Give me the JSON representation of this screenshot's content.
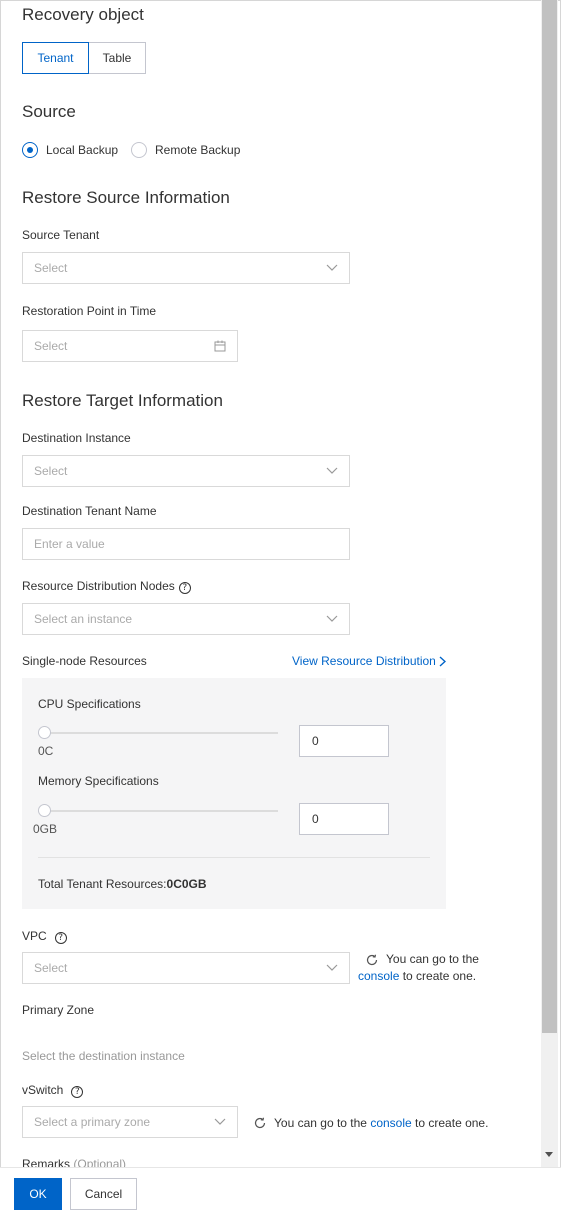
{
  "recovery_object": {
    "title": "Recovery object",
    "options": [
      "Tenant",
      "Table"
    ],
    "selected": "Tenant"
  },
  "source": {
    "title": "Source",
    "options": [
      "Local Backup",
      "Remote Backup"
    ],
    "selected": "Local Backup"
  },
  "restore_source": {
    "title": "Restore Source Information",
    "source_tenant_label": "Source Tenant",
    "source_tenant_placeholder": "Select",
    "restoration_point_label": "Restoration Point in Time",
    "restoration_point_placeholder": "Select"
  },
  "restore_target": {
    "title": "Restore Target Information",
    "destination_instance_label": "Destination Instance",
    "destination_instance_placeholder": "Select",
    "destination_tenant_name_label": "Destination Tenant Name",
    "destination_tenant_name_placeholder": "Enter a value",
    "resource_nodes_label": "Resource Distribution Nodes",
    "resource_nodes_placeholder": "Select an instance",
    "single_node_label": "Single-node Resources",
    "view_distribution_link": "View Resource Distribution"
  },
  "resources": {
    "cpu_label": "CPU Specifications",
    "cpu_value_text": "0C",
    "cpu_input": "0",
    "cpu_fraction": 0,
    "memory_label": "Memory Specifications",
    "memory_value_text": "0GB",
    "memory_input": "0",
    "memory_fraction": 0,
    "total_label": "Total Tenant Resources:",
    "total_value": "0C0GB"
  },
  "vpc": {
    "label": "VPC",
    "placeholder": "Select",
    "hint_prefix": "You can go to the",
    "hint_link": "console",
    "hint_suffix": "to create one."
  },
  "primary_zone": {
    "label": "Primary Zone",
    "hint": "Select the destination instance"
  },
  "vswitch": {
    "label": "vSwitch",
    "placeholder": "Select a primary zone",
    "hint_prefix": "You can go to the",
    "hint_link": "console",
    "hint_suffix": "to create one."
  },
  "remarks": {
    "label": "Remarks",
    "optional": "(Optional)"
  },
  "footer": {
    "ok_label": "OK",
    "cancel_label": "Cancel"
  },
  "colors": {
    "primary": "#0064c8",
    "border": "#d9d9d9",
    "panel_bg": "#f5f5f6"
  },
  "icons": {
    "chevron_down": "chevron-down-icon",
    "calendar": "calendar-icon",
    "refresh": "refresh-icon",
    "help": "help-icon",
    "chevron_right": "chevron-right-icon"
  }
}
